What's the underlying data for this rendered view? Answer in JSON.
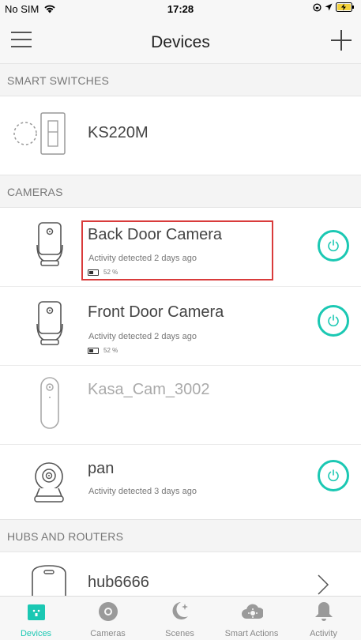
{
  "status_bar": {
    "carrier": "No SIM",
    "time": "17:28"
  },
  "nav": {
    "title": "Devices"
  },
  "sections": {
    "smart_switches": "SMART SWITCHES",
    "cameras": "CAMERAS",
    "hubs_and_routers": "HUBS AND ROUTERS"
  },
  "devices": {
    "switch": {
      "name": "KS220M"
    },
    "back_door": {
      "name": "Back Door Camera",
      "activity": "Activity detected 2 days ago",
      "battery": "52 %"
    },
    "front_door": {
      "name": "Front Door Camera",
      "activity": "Activity detected 2 days ago",
      "battery": "52 %"
    },
    "kasa_cam": {
      "name": "Kasa_Cam_3002"
    },
    "pan": {
      "name": "pan",
      "activity": "Activity detected 3 days ago"
    },
    "hub": {
      "name": "hub6666"
    }
  },
  "tabs": [
    {
      "label": "Devices",
      "icon": "devices-icon",
      "active": true
    },
    {
      "label": "Cameras",
      "icon": "cameras-icon",
      "active": false
    },
    {
      "label": "Scenes",
      "icon": "scenes-icon",
      "active": false
    },
    {
      "label": "Smart Actions",
      "icon": "smart-actions-icon",
      "active": false
    },
    {
      "label": "Activity",
      "icon": "activity-icon",
      "active": false
    }
  ],
  "colors": {
    "accent": "#1bc8b3",
    "highlight": "#d93b3b"
  }
}
